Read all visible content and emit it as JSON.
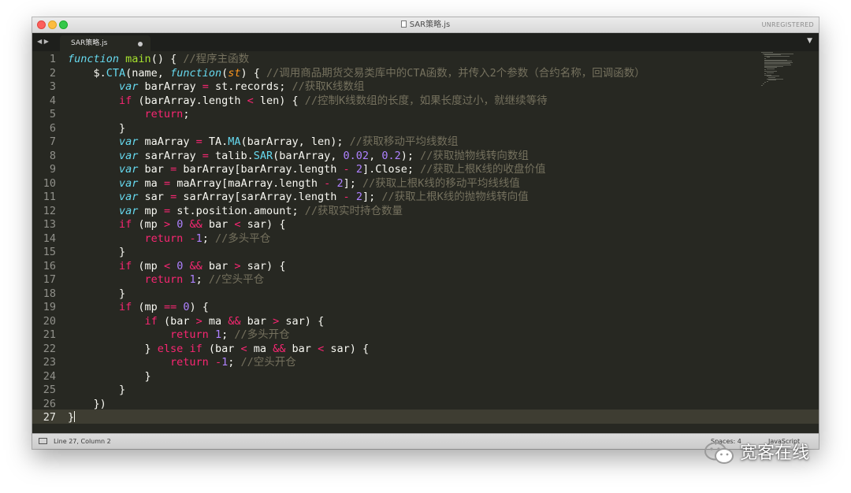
{
  "window": {
    "title": "SAR策略.js",
    "license_status": "UNREGISTERED"
  },
  "tabs": [
    {
      "label": "SAR策略.js",
      "modified": true
    }
  ],
  "editor": {
    "line_numbers": [
      "1",
      "2",
      "3",
      "4",
      "5",
      "6",
      "7",
      "8",
      "9",
      "10",
      "11",
      "12",
      "13",
      "14",
      "15",
      "16",
      "17",
      "18",
      "19",
      "20",
      "21",
      "22",
      "23",
      "24",
      "25",
      "26",
      "27"
    ],
    "active_line": 27,
    "lines": [
      [
        [
          "st",
          "function"
        ],
        [
          "p",
          " "
        ],
        [
          "fn",
          "main"
        ],
        [
          "p",
          "() { "
        ],
        [
          "cm",
          "//程序主函数"
        ]
      ],
      [
        [
          "p",
          "    $."
        ],
        [
          "sp",
          "CTA"
        ],
        [
          "p",
          "(name, "
        ],
        [
          "st",
          "function"
        ],
        [
          "p",
          "("
        ],
        [
          "pm",
          "st"
        ],
        [
          "p",
          ") { "
        ],
        [
          "cm",
          "//调用商品期货交易类库中的CTA函数，并传入2个参数（合约名称，回调函数）"
        ]
      ],
      [
        [
          "p",
          "        "
        ],
        [
          "st",
          "var"
        ],
        [
          "p",
          " barArray "
        ],
        [
          "kw",
          "="
        ],
        [
          "p",
          " st.records; "
        ],
        [
          "cm",
          "//获取K线数组"
        ]
      ],
      [
        [
          "p",
          "        "
        ],
        [
          "kw",
          "if"
        ],
        [
          "p",
          " (barArray.length "
        ],
        [
          "kw",
          "<"
        ],
        [
          "p",
          " len) { "
        ],
        [
          "cm",
          "//控制K线数组的长度，如果长度过小，就继续等待"
        ]
      ],
      [
        [
          "p",
          "            "
        ],
        [
          "kw",
          "return"
        ],
        [
          "p",
          ";"
        ]
      ],
      [
        [
          "p",
          "        }"
        ]
      ],
      [
        [
          "p",
          "        "
        ],
        [
          "st",
          "var"
        ],
        [
          "p",
          " maArray "
        ],
        [
          "kw",
          "="
        ],
        [
          "p",
          " TA."
        ],
        [
          "sp",
          "MA"
        ],
        [
          "p",
          "(barArray, len); "
        ],
        [
          "cm",
          "//获取移动平均线数组"
        ]
      ],
      [
        [
          "p",
          "        "
        ],
        [
          "st",
          "var"
        ],
        [
          "p",
          " sarArray "
        ],
        [
          "kw",
          "="
        ],
        [
          "p",
          " talib."
        ],
        [
          "sp",
          "SAR"
        ],
        [
          "p",
          "(barArray, "
        ],
        [
          "nm",
          "0.02"
        ],
        [
          "p",
          ", "
        ],
        [
          "nm",
          "0.2"
        ],
        [
          "p",
          "); "
        ],
        [
          "cm",
          "//获取抛物线转向数组"
        ]
      ],
      [
        [
          "p",
          "        "
        ],
        [
          "st",
          "var"
        ],
        [
          "p",
          " bar "
        ],
        [
          "kw",
          "="
        ],
        [
          "p",
          " barArray[barArray.length "
        ],
        [
          "kw",
          "-"
        ],
        [
          "p",
          " "
        ],
        [
          "nm",
          "2"
        ],
        [
          "p",
          "].Close; "
        ],
        [
          "cm",
          "//获取上根K线的收盘价值"
        ]
      ],
      [
        [
          "p",
          "        "
        ],
        [
          "st",
          "var"
        ],
        [
          "p",
          " ma "
        ],
        [
          "kw",
          "="
        ],
        [
          "p",
          " maArray[maArray.length "
        ],
        [
          "kw",
          "-"
        ],
        [
          "p",
          " "
        ],
        [
          "nm",
          "2"
        ],
        [
          "p",
          "]; "
        ],
        [
          "cm",
          "//获取上根K线的移动平均线线值"
        ]
      ],
      [
        [
          "p",
          "        "
        ],
        [
          "st",
          "var"
        ],
        [
          "p",
          " sar "
        ],
        [
          "kw",
          "="
        ],
        [
          "p",
          " sarArray[sarArray.length "
        ],
        [
          "kw",
          "-"
        ],
        [
          "p",
          " "
        ],
        [
          "nm",
          "2"
        ],
        [
          "p",
          "]; "
        ],
        [
          "cm",
          "//获取上根K线的抛物线转向值"
        ]
      ],
      [
        [
          "p",
          "        "
        ],
        [
          "st",
          "var"
        ],
        [
          "p",
          " mp "
        ],
        [
          "kw",
          "="
        ],
        [
          "p",
          " st.position.amount; "
        ],
        [
          "cm",
          "//获取实时持仓数量"
        ]
      ],
      [
        [
          "p",
          "        "
        ],
        [
          "kw",
          "if"
        ],
        [
          "p",
          " (mp "
        ],
        [
          "kw",
          ">"
        ],
        [
          "p",
          " "
        ],
        [
          "nm",
          "0"
        ],
        [
          "p",
          " "
        ],
        [
          "kw",
          "&&"
        ],
        [
          "p",
          " bar "
        ],
        [
          "kw",
          "<"
        ],
        [
          "p",
          " sar) {"
        ]
      ],
      [
        [
          "p",
          "            "
        ],
        [
          "kw",
          "return"
        ],
        [
          "p",
          " "
        ],
        [
          "kw",
          "-"
        ],
        [
          "nm",
          "1"
        ],
        [
          "p",
          "; "
        ],
        [
          "cm",
          "//多头平仓"
        ]
      ],
      [
        [
          "p",
          "        }"
        ]
      ],
      [
        [
          "p",
          "        "
        ],
        [
          "kw",
          "if"
        ],
        [
          "p",
          " (mp "
        ],
        [
          "kw",
          "<"
        ],
        [
          "p",
          " "
        ],
        [
          "nm",
          "0"
        ],
        [
          "p",
          " "
        ],
        [
          "kw",
          "&&"
        ],
        [
          "p",
          " bar "
        ],
        [
          "kw",
          ">"
        ],
        [
          "p",
          " sar) {"
        ]
      ],
      [
        [
          "p",
          "            "
        ],
        [
          "kw",
          "return"
        ],
        [
          "p",
          " "
        ],
        [
          "nm",
          "1"
        ],
        [
          "p",
          "; "
        ],
        [
          "cm",
          "//空头平仓"
        ]
      ],
      [
        [
          "p",
          "        }"
        ]
      ],
      [
        [
          "p",
          "        "
        ],
        [
          "kw",
          "if"
        ],
        [
          "p",
          " (mp "
        ],
        [
          "kw",
          "=="
        ],
        [
          "p",
          " "
        ],
        [
          "nm",
          "0"
        ],
        [
          "p",
          ") {"
        ]
      ],
      [
        [
          "p",
          "            "
        ],
        [
          "kw",
          "if"
        ],
        [
          "p",
          " (bar "
        ],
        [
          "kw",
          ">"
        ],
        [
          "p",
          " ma "
        ],
        [
          "kw",
          "&&"
        ],
        [
          "p",
          " bar "
        ],
        [
          "kw",
          ">"
        ],
        [
          "p",
          " sar) {"
        ]
      ],
      [
        [
          "p",
          "                "
        ],
        [
          "kw",
          "return"
        ],
        [
          "p",
          " "
        ],
        [
          "nm",
          "1"
        ],
        [
          "p",
          "; "
        ],
        [
          "cm",
          "//多头开仓"
        ]
      ],
      [
        [
          "p",
          "            } "
        ],
        [
          "kw",
          "else"
        ],
        [
          "p",
          " "
        ],
        [
          "kw",
          "if"
        ],
        [
          "p",
          " (bar "
        ],
        [
          "kw",
          "<"
        ],
        [
          "p",
          " ma "
        ],
        [
          "kw",
          "&&"
        ],
        [
          "p",
          " bar "
        ],
        [
          "kw",
          "<"
        ],
        [
          "p",
          " sar) {"
        ]
      ],
      [
        [
          "p",
          "                "
        ],
        [
          "kw",
          "return"
        ],
        [
          "p",
          " "
        ],
        [
          "kw",
          "-"
        ],
        [
          "nm",
          "1"
        ],
        [
          "p",
          "; "
        ],
        [
          "cm",
          "//空头开仓"
        ]
      ],
      [
        [
          "p",
          "            }"
        ]
      ],
      [
        [
          "p",
          "        }"
        ]
      ],
      [
        [
          "p",
          "    })"
        ]
      ],
      [
        [
          "p",
          "}"
        ]
      ]
    ]
  },
  "statusbar": {
    "cursor_position": "Line 27, Column 2",
    "indentation": "Spaces: 4",
    "syntax": "JavaScript"
  },
  "watermark": {
    "text": "宽客在线",
    "icon": "wechat-icon"
  },
  "colors": {
    "background": "#272822",
    "keyword": "#f92672",
    "storage": "#66d9ef",
    "function_name": "#a6e22e",
    "number": "#ae81ff",
    "parameter": "#fd971f",
    "comment": "#75715e",
    "text": "#f8f8f2"
  }
}
